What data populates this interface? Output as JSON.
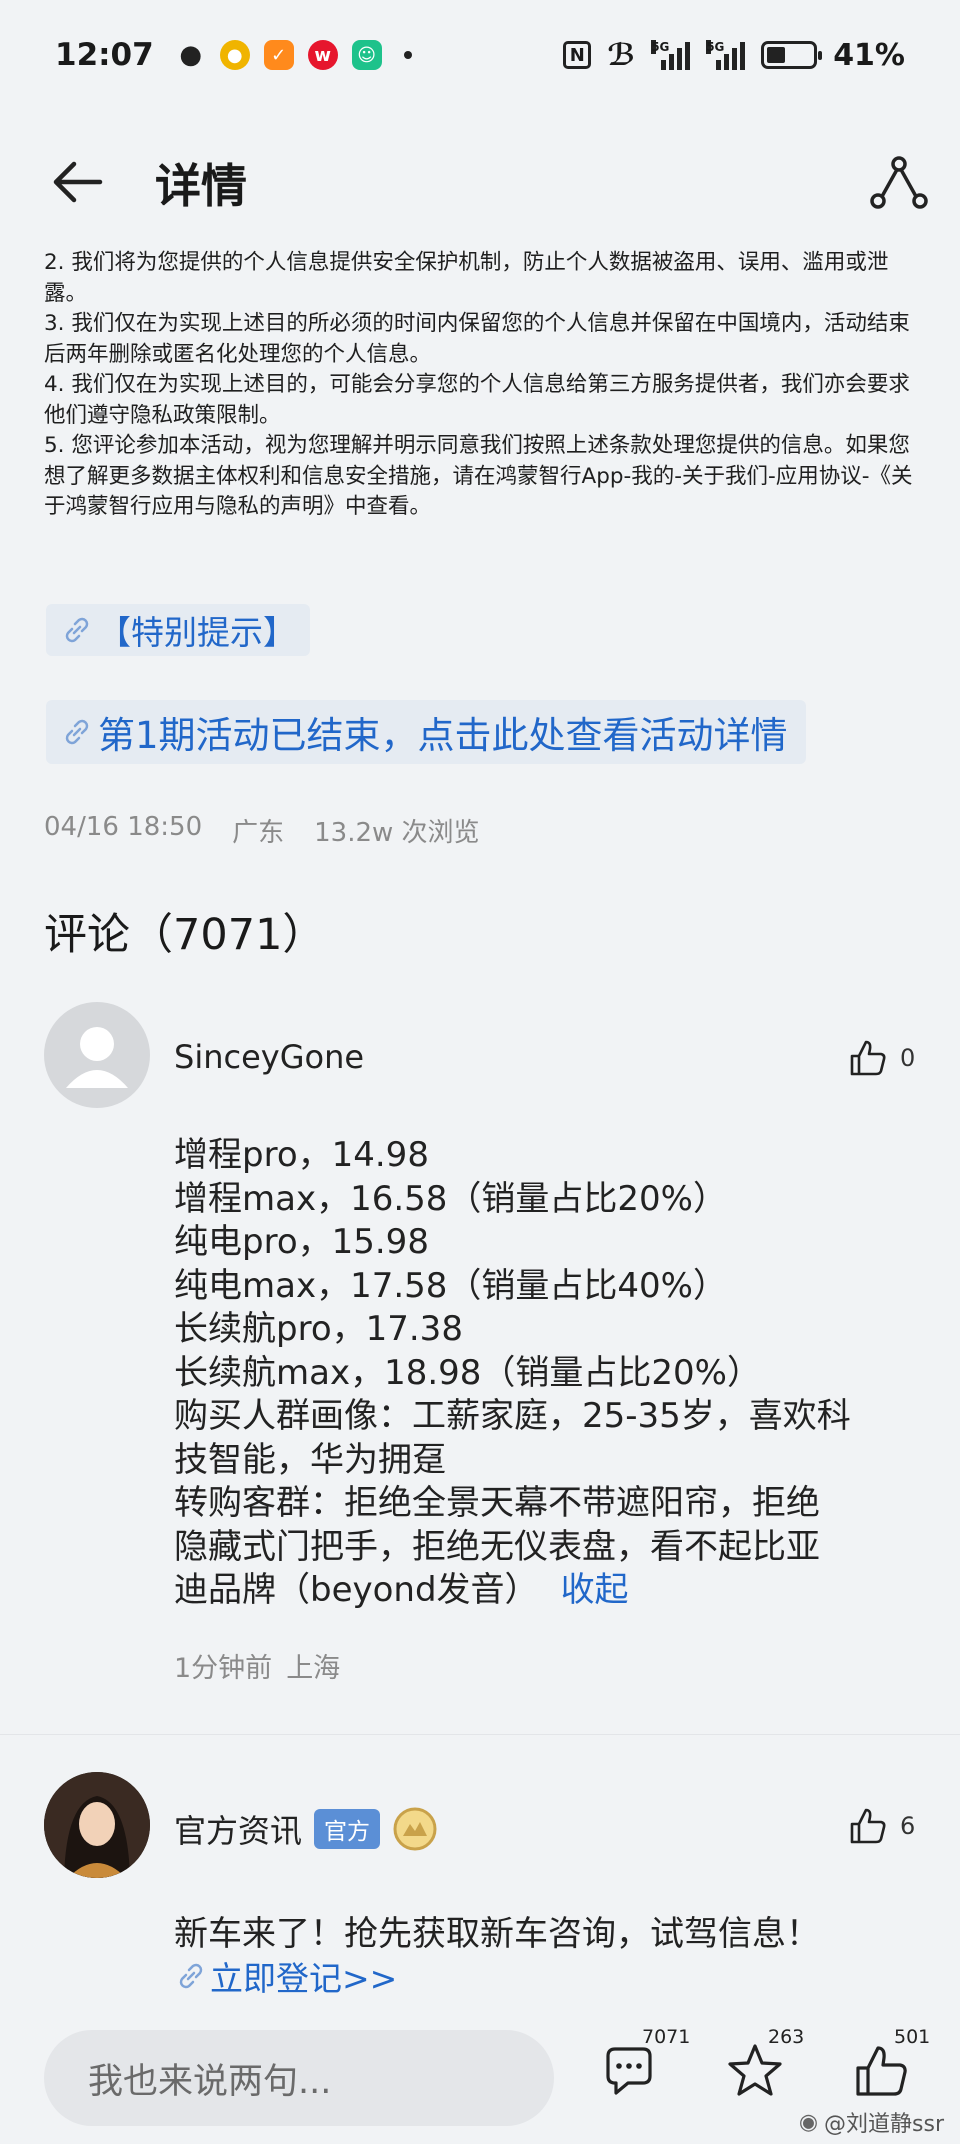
{
  "status_bar": {
    "time": "12:07",
    "apps": [
      "wechat-icon",
      "coin-app-icon",
      "orange-app-icon",
      "weibo-icon",
      "green-app-icon"
    ],
    "network": "5G",
    "battery": "41%",
    "battery_level": 0.41
  },
  "header": {
    "title": "详情"
  },
  "terms": [
    "2. 我们将为您提供的个人信息提供安全保护机制，防止个人数据被盗用、误用、滥用或泄露。",
    "3. 我们仅在为实现上述目的所必须的时间内保留您的个人信息并保留在中国境内，活动结束后两年删除或匿名化处理您的个人信息。",
    "4. 我们仅在为实现上述目的，可能会分享您的个人信息给第三方服务提供者，我们亦会要求他们遵守隐私政策限制。",
    "5. 您评论参加本活动，视为您理解并明示同意我们按照上述条款处理您提供的信息。如果您想了解更多数据主体权利和信息安全措施，请在鸿蒙智行App-我的-关于我们-应用协议-《关于鸿蒙智行应用与隐私的声明》中查看。"
  ],
  "links": {
    "special_notice": "【特别提示】",
    "activity_ended": "第1期活动已结束，点击此处查看活动详情"
  },
  "post_meta": {
    "date": "04/16 18:50",
    "location": "广东",
    "views": "13.2w 次浏览"
  },
  "comments_title": "评论（7071）",
  "comment1": {
    "user": "SinceyGone",
    "likes": "0",
    "lines": [
      "增程pro，14.98",
      "增程max，16.58（销量占比20%）",
      "纯电pro，15.98",
      "纯电max，17.58（销量占比40%）",
      "长续航pro，17.38",
      "长续航max，18.98（销量占比20%）",
      "购买人群画像：工薪家庭，25-35岁，喜欢科",
      "技智能，华为拥趸",
      "转购客群：拒绝全景天幕不带遮阳帘，拒绝",
      "隐藏式门把手，拒绝无仪表盘，看不起比亚",
      "迪品牌（beyond发音）"
    ],
    "collapse": "收起",
    "time": "1分钟前",
    "location": "上海"
  },
  "comment2": {
    "user": "官方资讯",
    "badge": "官方",
    "likes": "6",
    "text": "新车来了！抢先获取新车咨询，试驾信息！",
    "link": "立即登记>>"
  },
  "bottom_bar": {
    "placeholder": "我也来说两句...",
    "comment_count": "7071",
    "favorite_count": "263",
    "like_count": "501"
  },
  "watermark": "@刘道静ssr",
  "colors": {
    "background": "#f1f3f5",
    "link": "#2167c9",
    "link_bg": "#e5ebf2",
    "badge": "#5b8fd6",
    "muted": "#8a8a8a"
  }
}
